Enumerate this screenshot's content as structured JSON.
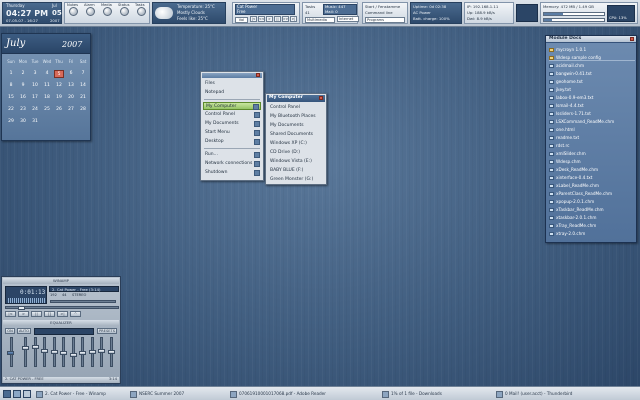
{
  "topbar": {
    "clock_day": "Thursday",
    "clock_month": "Jul",
    "clock_time": "04:27 PM",
    "clock_date_num": "05",
    "clock_full": "07-05-07 - 16:27",
    "clock_year": "2007",
    "launcher_labels": [
      "Nukes",
      "Alarm",
      "Media",
      "Status",
      "Tasks"
    ],
    "weather_temp": "Temperature: 25°C",
    "weather_cond": "Mostly Clouds",
    "weather_feels": "Feels like: 25°C",
    "now_playing": "Cat Power",
    "now_playing_sub": "Free",
    "vol_label": "Vol",
    "vol_value": "82",
    "media_buttons": [
      "|<",
      "<<",
      ">",
      "||",
      ">>",
      ">|"
    ],
    "tasks_label": "Tasks",
    "tasks_value": "41",
    "music_label": "Music: 447",
    "mail_label": "Mail: 0",
    "start_label": "Start / Fenstamme",
    "cmd_label": "Command line",
    "multimedia_label": "Multimedia",
    "internet_label": "Internet",
    "programs_label": "Programs",
    "uptime_label": "Uptime: 0d 02:38",
    "power_label": "AC Power",
    "batt_label": "Batt. charge: 100%",
    "ip_label": "IP: 192.168.1.11",
    "up_label": "Up: 188.9 kB/s",
    "down_label": "Dwl: 8.9 kB/s",
    "mem_label": "Memory: 472 MB / 1.49 GB",
    "disk_label": "CPU: 13%"
  },
  "calendar": {
    "month": "July",
    "year": "2007",
    "dow": [
      "Sun",
      "Mon",
      "Tue",
      "Wed",
      "Thu",
      "Fri",
      "Sat"
    ],
    "days": [
      "1",
      "2",
      "3",
      "4",
      "5",
      "6",
      "7",
      "8",
      "9",
      "10",
      "11",
      "12",
      "13",
      "14",
      "15",
      "16",
      "17",
      "18",
      "19",
      "20",
      "21",
      "22",
      "23",
      "24",
      "25",
      "26",
      "27",
      "28",
      "29",
      "30",
      "31"
    ],
    "today": "5",
    "first_weekday": 0,
    "accent": "#d86a5a"
  },
  "start_menu": {
    "items": [
      "Files",
      "Notepad",
      "My Computer",
      "Control Panel",
      "My Documents",
      "Start Menu",
      "Desktop",
      "Run...",
      "Network connections",
      "Shutdown"
    ],
    "highlighted": "My Computer"
  },
  "my_computer_menu": {
    "title": "My Computer",
    "items": [
      "Control Panel",
      "My Bluetooth Places",
      "My Documents",
      "Shared Documents",
      "Windows XP (C:)",
      "CD Drive (D:)",
      "Windows Vista (E:)",
      "BABY BLUE (F:)",
      "Green Monster (G:)"
    ]
  },
  "module_docs": {
    "title": "Module Docs",
    "items": [
      {
        "name": "mycroyn 1.0.1",
        "folder": true
      },
      {
        "name": "Wdesp sample config",
        "folder": true
      },
      {
        "name": "acidmail.chm",
        "folder": false
      },
      {
        "name": "bangwin-0.41.txt",
        "folder": false
      },
      {
        "name": "geohome.txt",
        "folder": false
      },
      {
        "name": "jkey.txt",
        "folder": false
      },
      {
        "name": "labox-0.9-em3.txt",
        "folder": false
      },
      {
        "name": "lsmail-4.4.txt",
        "folder": false
      },
      {
        "name": "lssliders-1.71.txt",
        "folder": false
      },
      {
        "name": "LSXCommand_ReadMe.chm",
        "folder": false
      },
      {
        "name": "one.html",
        "folder": false
      },
      {
        "name": "readme.txt",
        "folder": false
      },
      {
        "name": "rdst.rc",
        "folder": false
      },
      {
        "name": "xmlSlider.chm",
        "folder": false
      },
      {
        "name": "Wdesp.chm",
        "folder": false
      },
      {
        "name": "xDesk_ReadMe.chm",
        "folder": false
      },
      {
        "name": "xinterface-0.4.txt",
        "folder": false
      },
      {
        "name": "xLabel_ReadMe.chm",
        "folder": false
      },
      {
        "name": "xParentClass_ReadMe.chm",
        "folder": false
      },
      {
        "name": "xpopup-2.0.1.chm",
        "folder": false
      },
      {
        "name": "xTaskbar_ReadMe.chm",
        "folder": false
      },
      {
        "name": "xtaskbar-2.0.1.chm",
        "folder": false
      },
      {
        "name": "xTray_ReadMe.chm",
        "folder": false
      },
      {
        "name": "xtray-2.0.chm",
        "folder": false
      }
    ]
  },
  "winamp": {
    "title": "WINAMP",
    "time": "0:01:13",
    "track": "2. Cat Power - Free (3:14)",
    "kbps": "192",
    "khz": "44",
    "stereo": "STEREO",
    "eq_title": "EQUALIZER",
    "eq_on": "ON",
    "eq_auto": "AUTO",
    "eq_presets": "PRESETS",
    "playlist_title": "2. CAT POWER - FREE",
    "playlist_time": "3:14",
    "transport": [
      "|<",
      ">",
      "||",
      "[]",
      ">|",
      "^"
    ],
    "eq_bands": [
      0.35,
      0.3,
      0.45,
      0.5,
      0.55,
      0.6,
      0.55,
      0.5,
      0.45,
      0.5
    ]
  },
  "taskbar": {
    "items": [
      "2. Cat Power - Free - Winamp",
      "NSERC Summer 2007",
      "07061910001017068.pdf - Adobe Reader",
      "1% of 1 file - Downloads",
      "0 Mail! (user.acct) - Thunderbird"
    ]
  }
}
